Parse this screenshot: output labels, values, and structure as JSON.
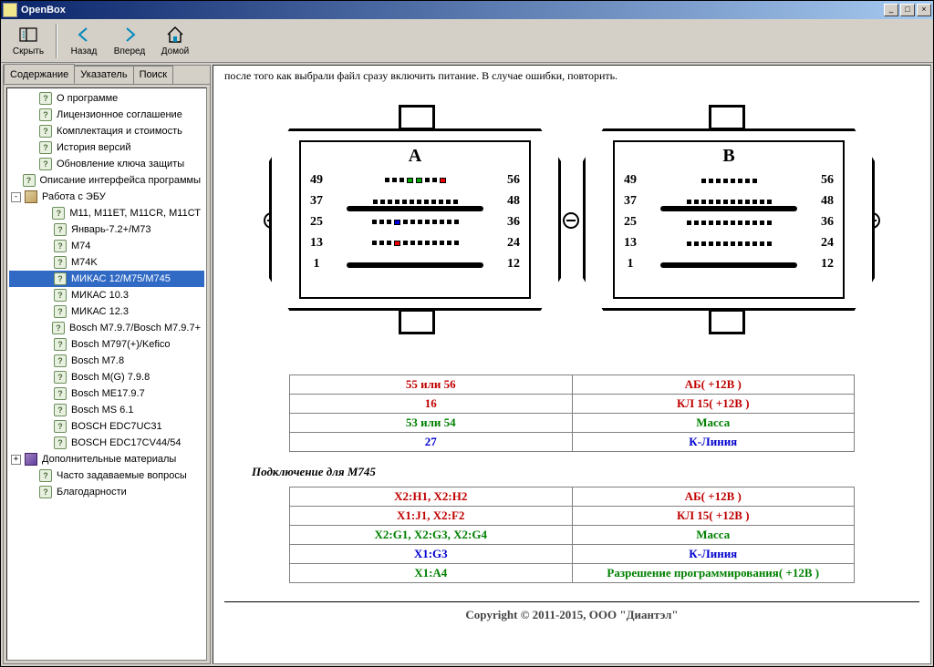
{
  "window": {
    "title": "OpenBox"
  },
  "toolbar": {
    "hide": "Скрыть",
    "back": "Назад",
    "forward": "Вперед",
    "home": "Домой"
  },
  "tabs": {
    "contents": "Содержание",
    "index": "Указатель",
    "search": "Поиск"
  },
  "tree": {
    "items": [
      {
        "label": "О программе",
        "type": "help",
        "indent": 1,
        "toggle": ""
      },
      {
        "label": "Лицензионное соглашение",
        "type": "help",
        "indent": 1,
        "toggle": ""
      },
      {
        "label": "Комплектация и стоимость",
        "type": "help",
        "indent": 1,
        "toggle": ""
      },
      {
        "label": "История версий",
        "type": "help",
        "indent": 1,
        "toggle": ""
      },
      {
        "label": "Обновление ключа защиты",
        "type": "help",
        "indent": 1,
        "toggle": ""
      },
      {
        "label": "Описание интерфейса программы",
        "type": "help",
        "indent": 1,
        "toggle": ""
      },
      {
        "label": "Работа с ЭБУ",
        "type": "book",
        "indent": 0,
        "toggle": "-"
      },
      {
        "label": "М11, М11ЕТ, М11CR, М11СТ",
        "type": "help",
        "indent": 2,
        "toggle": ""
      },
      {
        "label": "Январь-7.2+/М73",
        "type": "help",
        "indent": 2,
        "toggle": ""
      },
      {
        "label": "М74",
        "type": "help",
        "indent": 2,
        "toggle": ""
      },
      {
        "label": "М74K",
        "type": "help",
        "indent": 2,
        "toggle": ""
      },
      {
        "label": "МИКАС 12/М75/М745",
        "type": "help",
        "indent": 2,
        "toggle": "",
        "selected": true
      },
      {
        "label": "МИКАС 10.3",
        "type": "help",
        "indent": 2,
        "toggle": ""
      },
      {
        "label": "МИКАС 12.3",
        "type": "help",
        "indent": 2,
        "toggle": ""
      },
      {
        "label": "Bosch M7.9.7/Bosch M7.9.7+",
        "type": "help",
        "indent": 2,
        "toggle": ""
      },
      {
        "label": "Bosch M797(+)/Kefico",
        "type": "help",
        "indent": 2,
        "toggle": ""
      },
      {
        "label": "Bosch M7.8",
        "type": "help",
        "indent": 2,
        "toggle": ""
      },
      {
        "label": "Bosch M(G) 7.9.8",
        "type": "help",
        "indent": 2,
        "toggle": ""
      },
      {
        "label": "Bosch ME17.9.7",
        "type": "help",
        "indent": 2,
        "toggle": ""
      },
      {
        "label": "Bosch MS 6.1",
        "type": "help",
        "indent": 2,
        "toggle": ""
      },
      {
        "label": "BOSCH EDC7UC31",
        "type": "help",
        "indent": 2,
        "toggle": ""
      },
      {
        "label": "BOSCH EDC17CV44/54",
        "type": "help",
        "indent": 2,
        "toggle": ""
      },
      {
        "label": "Дополнительные материалы",
        "type": "bookp",
        "indent": 0,
        "toggle": "+"
      },
      {
        "label": "Часто задаваемые вопросы",
        "type": "help",
        "indent": 1,
        "toggle": ""
      },
      {
        "label": "Благодарности",
        "type": "help",
        "indent": 1,
        "toggle": ""
      }
    ]
  },
  "main": {
    "intro_text": "после того как выбрали файл сразу включить питание. В случае ошибки, повторить.",
    "connectors": {
      "a": {
        "label": "A",
        "rows": [
          [
            "49",
            "56"
          ],
          [
            "37",
            "48"
          ],
          [
            "25",
            "36"
          ],
          [
            "13",
            "24"
          ],
          [
            "1",
            "12"
          ]
        ]
      },
      "b": {
        "label": "B",
        "rows": [
          [
            "49",
            "56"
          ],
          [
            "37",
            "48"
          ],
          [
            "25",
            "36"
          ],
          [
            "13",
            "24"
          ],
          [
            "1",
            "12"
          ]
        ]
      }
    },
    "table1": [
      {
        "left": "55 или 56",
        "right": "АБ( +12В )",
        "cls": "c-red"
      },
      {
        "left": "16",
        "right": "КЛ 15( +12В )",
        "cls": "c-red"
      },
      {
        "left": "53 или 54",
        "right": "Масса",
        "cls": "c-green"
      },
      {
        "left": "27",
        "right": "К-Линия",
        "cls": "c-blue"
      }
    ],
    "section2_title": "Подключение для М745",
    "table2": [
      {
        "left": "X2:H1, X2:H2",
        "right": "АБ( +12В )",
        "cls": "c-red"
      },
      {
        "left": "X1:J1, X2:F2",
        "right": "КЛ 15( +12В )",
        "cls": "c-red"
      },
      {
        "left": "X2:G1, X2:G3, X2:G4",
        "right": "Масса",
        "cls": "c-green"
      },
      {
        "left": "X1:G3",
        "right": "К-Линия",
        "cls": "c-blue"
      },
      {
        "left": "X1:A4",
        "right": "Разрешение программирования( +12В )",
        "cls": "c-green"
      }
    ],
    "footer": "Copyright © 2011-2015, ООО \"Диантэл\""
  }
}
